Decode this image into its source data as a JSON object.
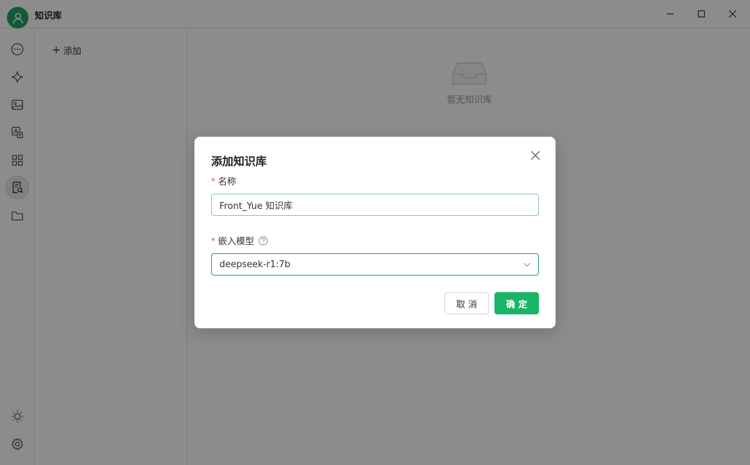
{
  "app": {
    "title": "知识库"
  },
  "sidebar": {
    "add_label": "添加"
  },
  "main": {
    "empty_text": "暂无知识库"
  },
  "dialog": {
    "title": "添加知识库",
    "name_label": "名称",
    "name_value": "Front_Yue 知识库",
    "model_label": "嵌入模型",
    "model_value": "deepseek-r1:7b",
    "required_mark": "*",
    "cancel_label": "取 消",
    "ok_label": "确 定"
  },
  "colors": {
    "accent": "#18b566",
    "avatar": "#1fa463",
    "required": "#e34d59"
  },
  "icons": [
    "user-icon",
    "chat-icon",
    "sparkle-icon",
    "image-icon",
    "translate-icon",
    "apps-icon",
    "knowledge-icon",
    "folder-icon",
    "sun-icon",
    "gear-icon",
    "inbox-icon",
    "question-icon",
    "chevron-down-icon",
    "close-icon"
  ]
}
